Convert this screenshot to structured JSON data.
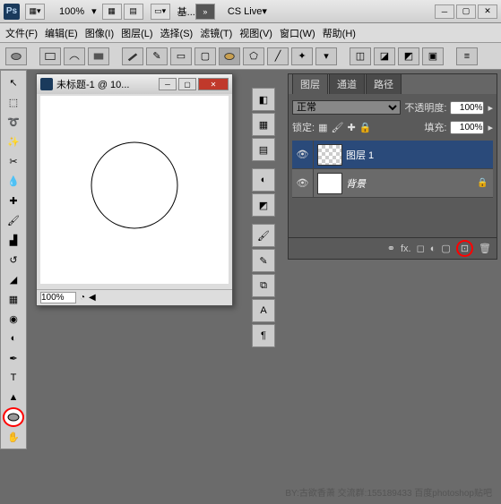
{
  "titlebar": {
    "zoom": "100%",
    "workspace": "基...",
    "cslive": "CS Live"
  },
  "menus": {
    "file": "文件(F)",
    "edit": "编辑(E)",
    "image": "图像(I)",
    "layer": "图层(L)",
    "select": "选择(S)",
    "filter": "滤镜(T)",
    "view": "视图(V)",
    "window": "窗口(W)",
    "help": "帮助(H)"
  },
  "doc": {
    "title": "未标题-1 @ 10...",
    "zoom": "100%"
  },
  "panel": {
    "tabs": {
      "layers": "图层",
      "channels": "通道",
      "paths": "路径"
    },
    "blend": "正常",
    "opacityLabel": "不透明度:",
    "opacity": "100%",
    "lockLabel": "锁定:",
    "fillLabel": "填充:",
    "fill": "100%",
    "layer1": "图层 1",
    "bg": "背景"
  },
  "watermark": "BY:古欲香萧   交流群:155189433   百度photoshop贴吧"
}
